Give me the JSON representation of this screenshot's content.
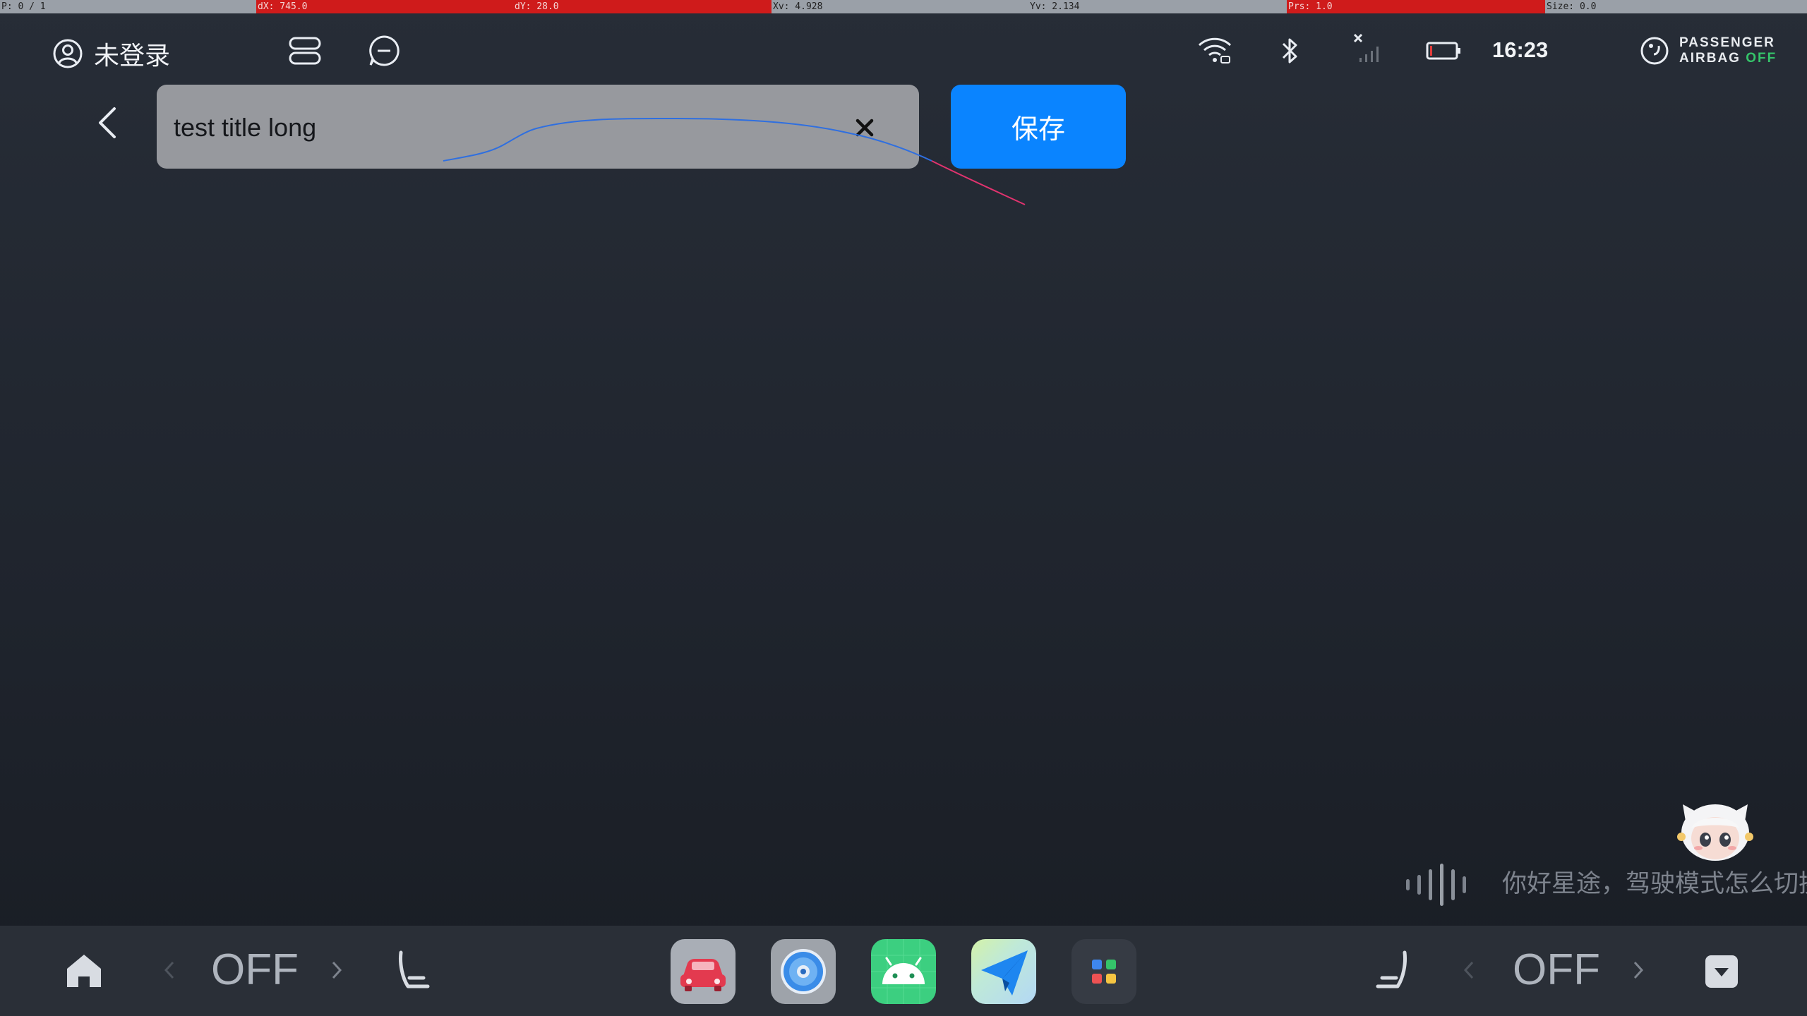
{
  "debug_bar": {
    "pointer": "P: 0 / 1",
    "dx": "dX: 745.0",
    "dy": "dY: 28.0",
    "xv": "Xv: 4.928",
    "yv": "Yv: 2.134",
    "prs": "Prs: 1.0",
    "size": "Size: 0.0"
  },
  "status_bar": {
    "login_label": "未登录",
    "time": "16:23",
    "airbag_line1": "PASSENGER",
    "airbag_line2": "AIRBAG",
    "airbag_state": "OFF",
    "icons": [
      "user-icon",
      "toggle-pills-icon",
      "message-icon",
      "wifi-icon",
      "bluetooth-icon",
      "no-signal-icon",
      "battery-icon",
      "airbag-icon"
    ]
  },
  "editor": {
    "title_value": "test title long",
    "save_label": "保存"
  },
  "voice": {
    "hint_text": "你好星途，驾驶模式怎么切换"
  },
  "dock": {
    "left_climate": "OFF",
    "right_climate": "OFF",
    "apps": [
      "car-app",
      "music-disc-app",
      "android-app",
      "navigation-app",
      "app-grid"
    ]
  },
  "colors": {
    "accent": "#0a84ff",
    "airbag_off": "#35c46a",
    "debug_red": "#cf1b1b"
  }
}
